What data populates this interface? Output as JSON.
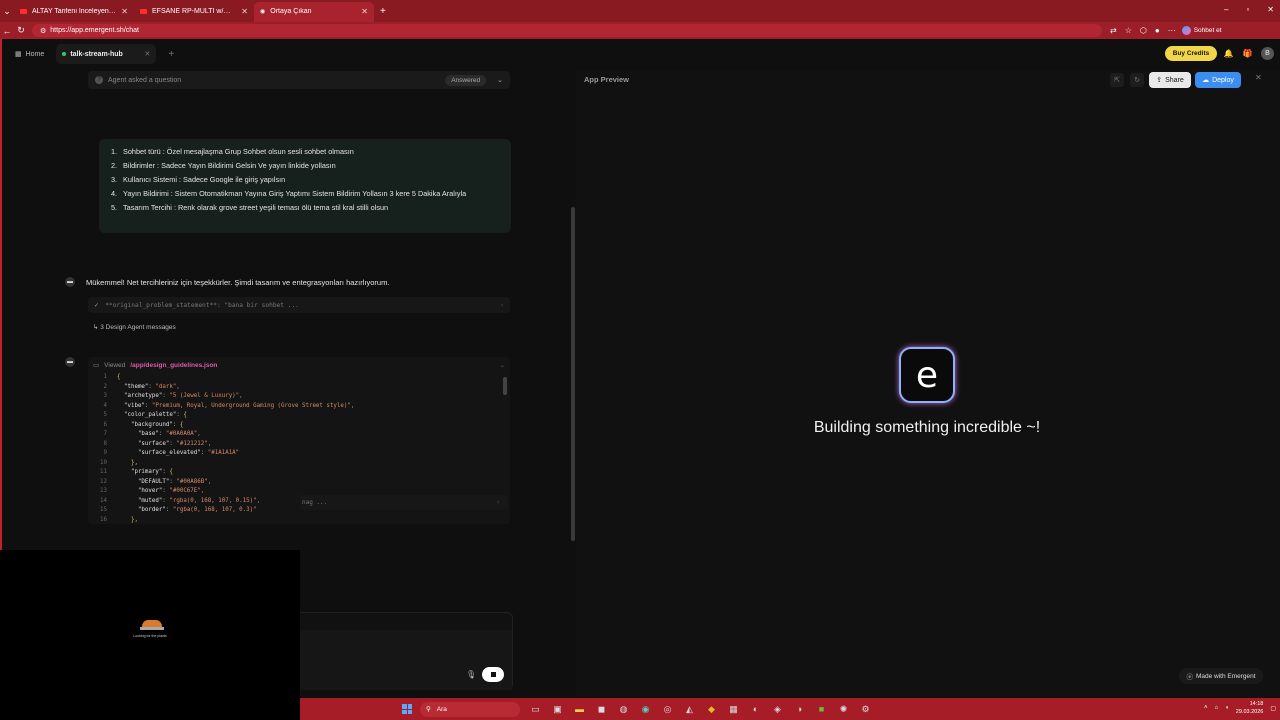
{
  "browser": {
    "tabs": [
      {
        "label": "ALTAY Tarifeni İnceleyen ALBAYA C…"
      },
      {
        "label": "EFSANE RP-MULTI w/@Maxmarine…"
      },
      {
        "label": "Ortaya Çıkan"
      }
    ],
    "url": "https://app.emergent.sh/chat",
    "profile_label": "Sohbet et"
  },
  "app": {
    "home_label": "Home",
    "tab_label": "talk-stream-hub",
    "buy_credits": "Buy Credits",
    "avatar": "B"
  },
  "chat": {
    "asked": {
      "label": "Agent asked a question",
      "status": "Answered"
    },
    "user_list": [
      {
        "num": "1.",
        "text": "Sohbet türü : Özel mesajlaşma Grup Sohbet olsun sesli sohbet olmasın"
      },
      {
        "num": "2.",
        "text": "Bildirimler : Sadece Yayın Bildirimi Gelsin Ve yayın linkide yollasın"
      },
      {
        "num": "3.",
        "text": "Kullanıcı Sistemi : Sadece Google ile giriş yapılsın"
      },
      {
        "num": "4.",
        "text": "Yayın Bildirimi : Sistem Otomatikman Yayına Giriş Yaptımı Sistem Bildirim Yollasın 3 kere 5 Dakika Aralıyla"
      },
      {
        "num": "5.",
        "text": "Tasarım Tercihi : Renk olarak grove street yeşili teması ölü tema stil kral stilli olsun"
      }
    ],
    "bot_message": "Mükemmel! Net tercihleriniz için teşekkürler. Şimdi tasarım ve entegrasyonları hazırlıyorum.",
    "tool_summary": "**original_problem_statement**: \"bana bir sohbet ...",
    "design_messages": "3 Design Agent messages",
    "viewed_label": "Viewed",
    "viewed_path": "/app/design_guidelines.json",
    "code_lines": [
      {
        "n": "1",
        "t": "{"
      },
      {
        "n": "2",
        "t": "  \"theme\": \"dark\","
      },
      {
        "n": "3",
        "t": "  \"archetype\": \"5 (Jewel & Luxury)\","
      },
      {
        "n": "4",
        "t": "  \"vibe\": \"Premium, Royal, Underground Gaming (Grove Street style)\","
      },
      {
        "n": "5",
        "t": "  \"color_palette\": {"
      },
      {
        "n": "6",
        "t": "    \"background\": {"
      },
      {
        "n": "7",
        "t": "      \"base\": \"#0A0A0A\","
      },
      {
        "n": "8",
        "t": "      \"surface\": \"#121212\","
      },
      {
        "n": "9",
        "t": "      \"surface_elevated\": \"#1A1A1A\""
      },
      {
        "n": "10",
        "t": "    },"
      },
      {
        "n": "11",
        "t": "    \"primary\": {"
      },
      {
        "n": "12",
        "t": "      \"DEFAULT\": \"#00A86B\","
      },
      {
        "n": "13",
        "t": "      \"hover\": \"#00C67E\","
      },
      {
        "n": "14",
        "t": "      \"muted\": \"rgba(0, 168, 107, 0.15)\","
      },
      {
        "n": "15",
        "t": "      \"border\": \"rgba(0, 168, 107, 0.3)\""
      },
      {
        "n": "16",
        "t": "    },"
      }
    ],
    "tool2_summary": "nag ..."
  },
  "webcam": {
    "caption": "Looking for the plants"
  },
  "preview": {
    "title": "App Preview",
    "share": "Share",
    "deploy": "Deploy",
    "logo_letter": "e",
    "building": "Building something incredible ~!",
    "made_with": "Made with Emergent"
  },
  "taskbar": {
    "search": "Ara",
    "time": "14:18",
    "date": "29.03.2026"
  },
  "colors": {
    "accent_red": "#a61d28",
    "deploy_blue": "#3b8ef0",
    "credits_yellow": "#f2d64a"
  }
}
